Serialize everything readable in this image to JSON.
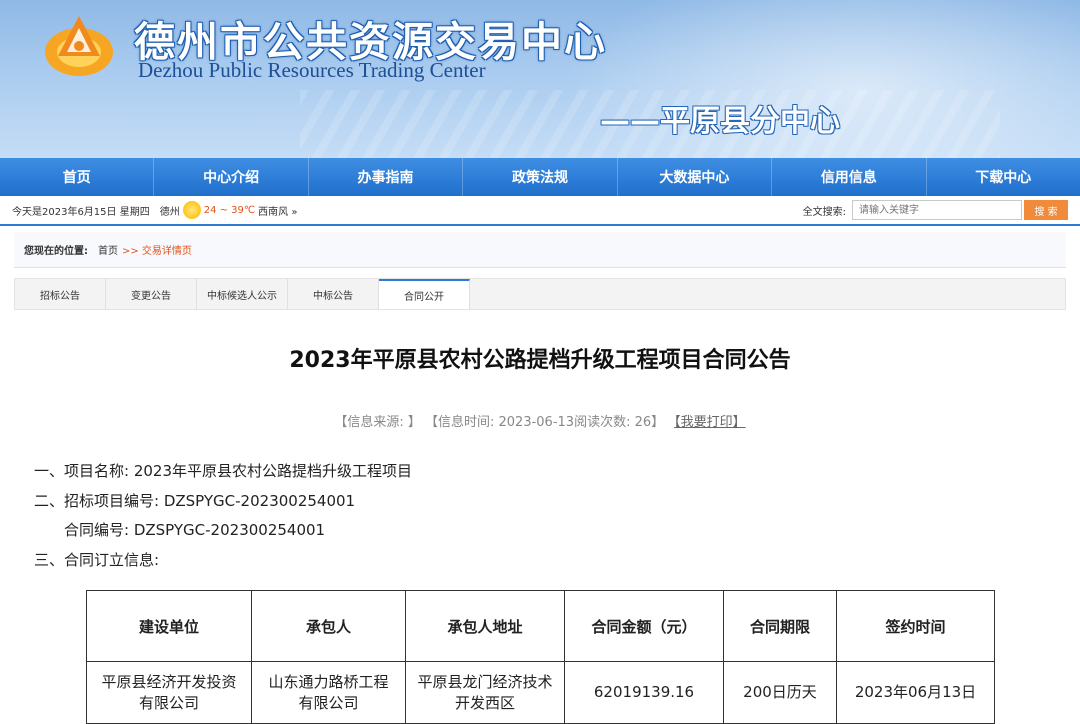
{
  "header": {
    "title_cn": "德州市公共资源交易中心",
    "title_en": "Dezhou Public Resources Trading Center",
    "subcenter": "——平原县分中心"
  },
  "nav": [
    "首页",
    "中心介绍",
    "办事指南",
    "政策法规",
    "大数据中心",
    "信用信息",
    "下载中心"
  ],
  "infobar": {
    "date": "今天是2023年6月15日 星期四",
    "city": "德州",
    "weather_icon": "sun-icon",
    "temp": "24 ~ 39℃",
    "wind": "西南风 »",
    "search_label": "全文搜索:",
    "search_placeholder": "请输入关键字",
    "search_button": "搜 索"
  },
  "breadcrumb": {
    "label": "您现在的位置:",
    "home": "首页",
    "current": ">> 交易详情页"
  },
  "tabs": [
    "招标公告",
    "变更公告",
    "中标候选人公示",
    "中标公告",
    "合同公开"
  ],
  "active_tab": "合同公开",
  "article": {
    "title": "2023年平原县农村公路提档升级工程项目合同公告",
    "meta": "【信息来源: 】 【信息时间: 2023-06-13阅读次数: 26】",
    "print": "【我要打印】",
    "line1": "一、项目名称: 2023年平原县农村公路提档升级工程项目",
    "line2": "二、招标项目编号: DZSPYGC-202300254001",
    "line3": "合同编号: DZSPYGC-202300254001",
    "line4": "三、合同订立信息:"
  },
  "table": {
    "headers": [
      "建设单位",
      "承包人",
      "承包人地址",
      "合同金额（元）",
      "合同期限",
      "签约时间"
    ],
    "row": [
      "平原县经济开发投资有限公司",
      "山东通力路桥工程有限公司",
      "平原县龙门经济技术开发西区",
      "62019139.16",
      "200日历天",
      "2023年06月13日"
    ]
  }
}
